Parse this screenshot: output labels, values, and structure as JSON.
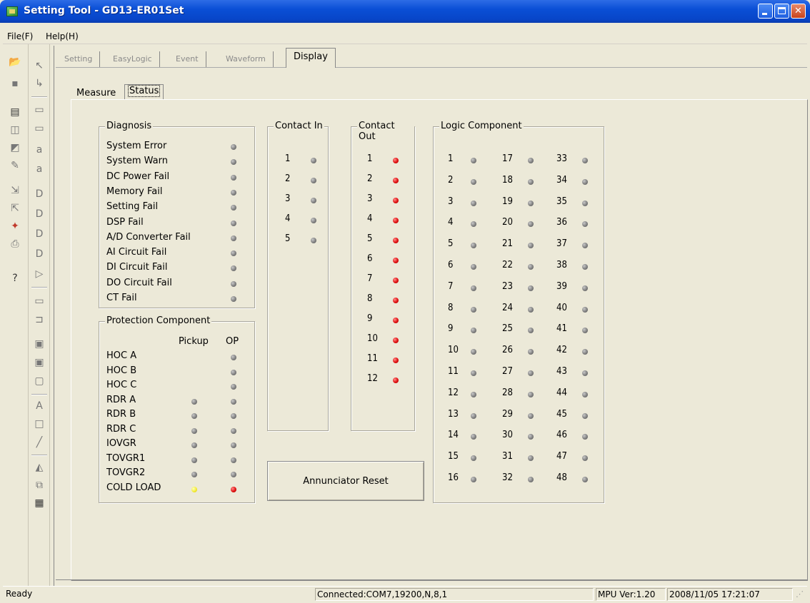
{
  "window": {
    "title": "Setting Tool - GD13-ER01Set"
  },
  "menu": {
    "items": [
      "File(F)",
      "Help(H)"
    ]
  },
  "tabs": [
    "Setting",
    "EasyLogic",
    "Event",
    "Waveform",
    "Display"
  ],
  "subtabs": {
    "measure": "Measure",
    "status": "Status"
  },
  "diagnosis": {
    "title": "Diagnosis",
    "items": [
      "System Error",
      "System Warn",
      "DC Power Fail",
      "Memory Fail",
      "Setting Fail",
      "DSP Fail",
      "A/D Converter Fail",
      "AI Circuit Fail",
      "DI Circuit Fail",
      "DO Circuit Fail",
      "CT Fail"
    ]
  },
  "protection": {
    "title": "Protection Component",
    "col_pickup": "Pickup",
    "col_op": "OP",
    "rows": [
      {
        "label": "HOC A",
        "pickup": null,
        "op": "gray"
      },
      {
        "label": "HOC B",
        "pickup": null,
        "op": "gray"
      },
      {
        "label": "HOC C",
        "pickup": null,
        "op": "gray"
      },
      {
        "label": "RDR A",
        "pickup": "gray",
        "op": "gray"
      },
      {
        "label": "RDR B",
        "pickup": "gray",
        "op": "gray"
      },
      {
        "label": "RDR C",
        "pickup": "gray",
        "op": "gray"
      },
      {
        "label": "IOVGR",
        "pickup": "gray",
        "op": "gray"
      },
      {
        "label": "TOVGR1",
        "pickup": "gray",
        "op": "gray"
      },
      {
        "label": "TOVGR2",
        "pickup": "gray",
        "op": "gray"
      },
      {
        "label": "COLD LOAD",
        "pickup": "yellow",
        "op": "red"
      }
    ]
  },
  "contact_in": {
    "title": "Contact In",
    "items": [
      "1",
      "2",
      "3",
      "4",
      "5"
    ]
  },
  "contact_out": {
    "title": "Contact Out",
    "items": [
      "1",
      "2",
      "3",
      "4",
      "5",
      "6",
      "7",
      "8",
      "9",
      "10",
      "11",
      "12"
    ]
  },
  "logic": {
    "title": "Logic Component",
    "count": 48
  },
  "reset_button": "Annunciator Reset",
  "status": {
    "left": "Ready",
    "connection": "Connected:COM7,19200,N,8,1",
    "mpu": "MPU Ver:1.20",
    "datetime": "2008/11/05 17:21:07"
  },
  "colors": {
    "led_gray": "#7a7a7a",
    "led_red": "#e01010",
    "led_yellow": "#f2ea30",
    "titlebar": "#0a4fd6"
  }
}
